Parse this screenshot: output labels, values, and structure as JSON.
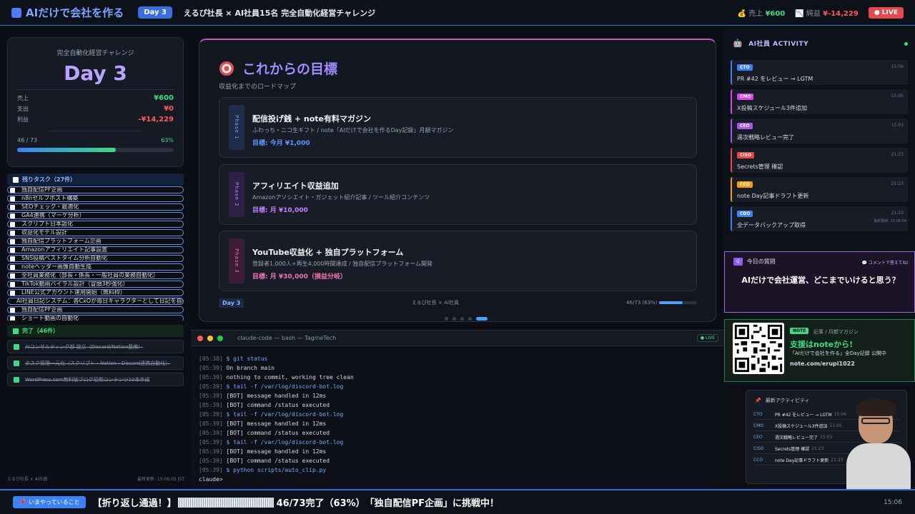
{
  "header": {
    "logo": "AIだけで会社を作る",
    "day_badge": "Day 3",
    "title": "えるぴ社長 × AI社員15名 完全自動化経営チャレンジ",
    "sales_label": "売上",
    "sales_value": "¥600",
    "cost_label": "純益",
    "cost_value": "¥-14,229",
    "live": "● LIVE"
  },
  "summary": {
    "subtitle": "完全自動化経営チャレンジ",
    "day": "Day 3",
    "rows": [
      {
        "label": "売上",
        "value": "¥600"
      },
      {
        "label": "支出",
        "value": "¥0"
      },
      {
        "label": "利益",
        "value": "-¥14,229"
      }
    ],
    "progress_text": "46 / 73",
    "progress_pct": "63%",
    "progress_fraction": 0.63
  },
  "remaining": {
    "label": "残りタスク（27件）",
    "items": [
      "独自配信PF企画",
      "n8nセルフホスト構築",
      "SEOチェック・最適化",
      "GA4連携（マーケ分析）",
      "スクリプト日本語化",
      "収益化モデル設計",
      "独自配信プラットフォーム企画",
      "Amazonアフィリエイト記事設置",
      "SNS投稿ベストタイム分析自動化",
      "noteヘッダー画像自動生成",
      "全社員業務化（部長・係長・一般社員の業務自動化）",
      "TikTok動画バイラル設計（冒頭3秒強化）",
      "LINE公式アカウント運用開始（無料枠）",
      "AI社員日記システム：各CxOが毎日キャラクターとして日記を自動...",
      "独自配信PF企画",
      "ショート動画の自動化"
    ]
  },
  "completed": {
    "label": "完了（46件）",
    "items": [
      "AIコンサルティング部 設立（Discord/Notion整備）",
      "タスク管理一元化（スクリプト・Notion・Discord連携自動化）",
      "WordPress.com無料版ブログ初期コンテンツ10本作成"
    ]
  },
  "left_footer": {
    "left": "えるぴ社長 × AI社員",
    "right": "最終更新: 15:06:05 JST"
  },
  "roadmap": {
    "title": "これからの目標",
    "subtitle": "収益化までのロードマップ",
    "phases": [
      {
        "tag": "Phase 1",
        "title": "配信投げ銭 + note有料マガジン",
        "desc": "ふわっち・ニコ生ギフト / note「AIだけで会社を作るDay記録」月額マガジン",
        "goal": "目標: 今月 ¥1,000",
        "color": "#3b82f6"
      },
      {
        "tag": "Phase 2",
        "title": "アフィリエイト収益追加",
        "desc": "Amazonアソシエイト・ガジェット紹介記事 / ツール紹介コンテンツ",
        "goal": "目標: 月 ¥10,000",
        "color": "#a855f7"
      },
      {
        "tag": "Phase 3",
        "title": "YouTube収益化 + 独自プラットフォーム",
        "desc": "登録者1,000人+再生4,000時間達成 / 独自配信プラットフォーム開発",
        "goal": "目標: 月 ¥30,000（損益分岐）",
        "color": "#ec4899"
      }
    ],
    "footer_day": "Day 3",
    "footer_center": "えるぴ社長 × AI社員",
    "footer_progress": "46/73 (63%)",
    "progress_fraction": 0.63
  },
  "terminal": {
    "title": "claude-code — bash — TagmeTech",
    "live": "● LIVE",
    "lines": [
      {
        "ts": "[05:38]",
        "text": "$ git status",
        "cmd": true
      },
      {
        "ts": "[05:39]",
        "text": "On branch main",
        "cmd": false
      },
      {
        "ts": "[05:39]",
        "text": "nothing to commit, working tree clean",
        "cmd": false
      },
      {
        "ts": "[05:39]",
        "text": "$ tail -f /var/log/discord-bot.log",
        "cmd": true
      },
      {
        "ts": "[05:39]",
        "text": "[BOT] message handled in 12ms",
        "cmd": false
      },
      {
        "ts": "[05:39]",
        "text": "[BOT] command /status executed",
        "cmd": false
      },
      {
        "ts": "[05:39]",
        "text": "$ tail -f /var/log/discord-bot.log",
        "cmd": true
      },
      {
        "ts": "[05:39]",
        "text": "[BOT] message handled in 12ms",
        "cmd": false
      },
      {
        "ts": "[05:39]",
        "text": "[BOT] command /status executed",
        "cmd": false
      },
      {
        "ts": "[05:39]",
        "text": "$ tail -f /var/log/discord-bot.log",
        "cmd": true
      },
      {
        "ts": "[05:39]",
        "text": "[BOT] message handled in 12ms",
        "cmd": false
      },
      {
        "ts": "[05:39]",
        "text": "[BOT] command /status executed",
        "cmd": false
      },
      {
        "ts": "[05:39]",
        "text": "$ python scripts/auto_clip.py",
        "cmd": true
      }
    ],
    "prompt": "claude>"
  },
  "activity": {
    "title": "AI社員 ACTIVITY",
    "items": [
      {
        "role": "CTO",
        "msg": "PR #42 をレビュー → LGTM",
        "time": "15:06",
        "color": "#3b82f6"
      },
      {
        "role": "CMO",
        "msg": "X投稿スケジュール3件追加",
        "time": "15:05",
        "color": "#d946ef"
      },
      {
        "role": "CEO",
        "msg": "週次戦略レビュー完了",
        "time": "15:03",
        "color": "#a855f7"
      },
      {
        "role": "CISO",
        "msg": "Secrets管理 確認",
        "time": "21:23",
        "color": "#ef4444"
      },
      {
        "role": "CCO",
        "msg": "note Day記事ドラフト更新",
        "time": "21:23",
        "color": "#f59e0b"
      },
      {
        "role": "CDO",
        "msg": "全データバックアップ取得",
        "time": "21:23",
        "color": "#3b82f6"
      }
    ],
    "updated": "最終更新: 15:06:04"
  },
  "question": {
    "badge": "Q",
    "label": "今日の質問",
    "hint": "💬 コメントで答えてね!",
    "text": "AIだけで会社運営、どこまでいけると思う？"
  },
  "note": {
    "tag": "NOTE",
    "sub": "記事 / 月額マガジン",
    "headline": "支援はnoteから!",
    "desc": "「AIだけで会社を作る」全Day記録 公開中",
    "url": "note.com/erupi1022"
  },
  "recent": {
    "title": "最新アクティビティ",
    "rows": [
      {
        "role": "CTO",
        "msg": "PR #42 をレビュー → LGTM",
        "time": "15:06"
      },
      {
        "role": "CMO",
        "msg": "X投稿スケジュール3件追加",
        "time": "15:05"
      },
      {
        "role": "CEO",
        "msg": "週次戦略レビュー完了",
        "time": "15:03"
      },
      {
        "role": "CISO",
        "msg": "Secrets管理 確認",
        "time": "21:23"
      },
      {
        "role": "CCO",
        "msg": "note Day記事ドラフト更新",
        "time": "21:23"
      }
    ]
  },
  "footer": {
    "now_label": "いまやっていること",
    "ticker_a": "【折り返し通過！】",
    "ticker_b": "46/73完了（63%）　「独自配信PF企画」に挑戦中！",
    "clock": "15:06"
  }
}
